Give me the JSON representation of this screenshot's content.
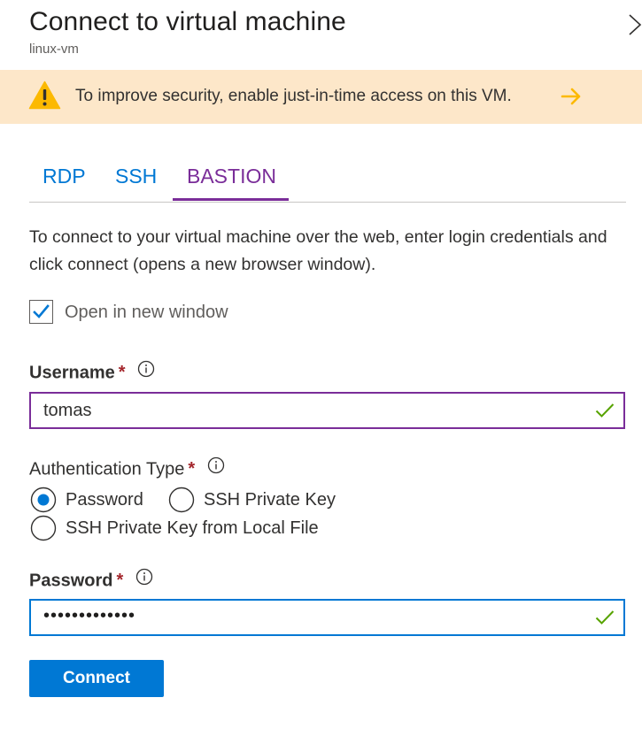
{
  "header": {
    "title": "Connect to virtual machine",
    "subtitle": "linux-vm",
    "close_icon": "close-chevron-icon"
  },
  "banner": {
    "icon": "warning-icon",
    "text": "To improve security, enable just-in-time access on this VM.",
    "arrow_icon": "arrow-right-icon",
    "warning_color": "#fcb900",
    "background": "#fde7c9"
  },
  "tabs": [
    {
      "label": "RDP",
      "active": false
    },
    {
      "label": "SSH",
      "active": false
    },
    {
      "label": "BASTION",
      "active": true
    }
  ],
  "description": "To connect to your virtual machine over the web, enter login credentials and click connect (opens a new browser window).",
  "open_in_new_window": {
    "label": "Open in new window",
    "checked": true
  },
  "username": {
    "label": "Username",
    "required_mark": "*",
    "value": "tomas",
    "valid": true
  },
  "auth_type": {
    "label": "Authentication Type",
    "required_mark": "*",
    "options": [
      {
        "label": "Password",
        "selected": true
      },
      {
        "label": "SSH Private Key",
        "selected": false
      },
      {
        "label": "SSH Private Key from Local File",
        "selected": false
      }
    ]
  },
  "password": {
    "label": "Password",
    "required_mark": "*",
    "masked_value": "•••••••••••••",
    "valid": true
  },
  "connect_button": {
    "label": "Connect"
  },
  "colors": {
    "accent_blue": "#0078d4",
    "active_tab_purple": "#7a2d99",
    "valid_green": "#57a300",
    "required_red": "#a4262c"
  }
}
